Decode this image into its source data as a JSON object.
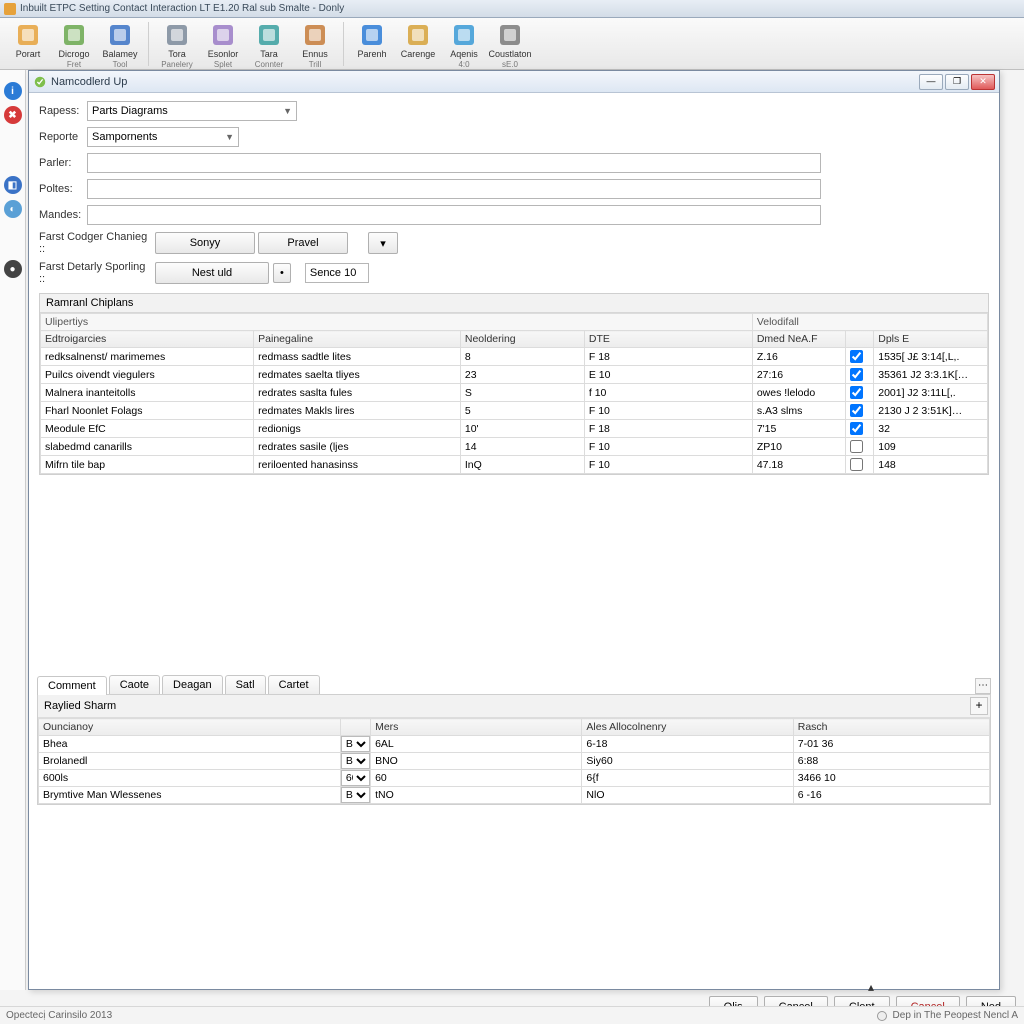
{
  "app_title": "Inbuilt ETPC Setting Contact Interaction LT E1.20 Ral sub Smalte - Donly",
  "ribbon": [
    {
      "label": "Porart",
      "sub": ""
    },
    {
      "label": "Dicrogo",
      "sub": "Fret"
    },
    {
      "label": "Balamey",
      "sub": "Tool"
    },
    {
      "label": "Tora",
      "sub": "Panelery"
    },
    {
      "label": "Esonlor",
      "sub": "Splet"
    },
    {
      "label": "Tara",
      "sub": "Connter"
    },
    {
      "label": "Ennus",
      "sub": "Trill"
    },
    {
      "label": "Parenh",
      "sub": ""
    },
    {
      "label": "Carenge",
      "sub": ""
    },
    {
      "label": "Aqenis",
      "sub": "4:0"
    },
    {
      "label": "Coustlaton",
      "sub": "sE.0"
    }
  ],
  "dialog_title": "Namcodlerd Up",
  "form": {
    "rapess_label": "Rapess:",
    "rapess_value": "Parts Diagrams",
    "reporte_label": "Reporte",
    "reporte_value": "Sampornents",
    "parler_label": "Parler:",
    "parler_value": "",
    "poltes_label": "Poltes:",
    "poltes_value": "",
    "mandes_label": "Mandes:",
    "mandes_value": "",
    "codger_label": "Farst Codger Chanieg ::",
    "sonyy_btn": "Sonyy",
    "pravel_btn": "Pravel",
    "detary_label": "Farst Detarly Sporling ::",
    "nest_btn": "Nest uld",
    "sence_label": "Sence 10"
  },
  "grid1": {
    "title": "Ramranl Chiplans",
    "sub_left": "Ulipertiys",
    "sub_right": "Velodifall",
    "cols": [
      "Edtroigarcies",
      "Painegaline",
      "Neoldering",
      "DTE",
      "Dmed NeA.F",
      "",
      "Dpls E"
    ],
    "rows": [
      [
        "redksalnenst/ marimemes",
        "redmass sadtle lites",
        "8",
        "F 18",
        "Z.16",
        "✓",
        "1535[ J£ 3:14[,L,."
      ],
      [
        "Puilcs oivendt viegulers",
        "redmates saelta tliyes",
        "23",
        "E 10",
        "27:16",
        "✓",
        "35361 J2 3:3.1K[…"
      ],
      [
        "Malnera inanteitolls",
        "redrates saslta fules",
        "S",
        "f 10",
        "owes !lelodo",
        "✓",
        "2001] J2 3:11L[,."
      ],
      [
        "Fharl Noonlet Folags",
        "redmates Makls lires",
        "5",
        "F 10",
        "s.A3 slms",
        "✓",
        "2130 J 2 3:51K]…"
      ],
      [
        "Meodule EfC",
        "redionigs",
        "10'",
        "F 18",
        "7'15",
        "✓",
        "32"
      ],
      [
        "slabedmd canarills",
        "redrates sasile (ljes",
        "14",
        "F 10",
        "ZP10",
        "",
        "109"
      ],
      [
        "Mifrn tile bap",
        "reriloented hanasinss",
        "InQ",
        "F 10",
        "47.18",
        "",
        "148"
      ]
    ]
  },
  "tabs": [
    "Comment",
    "Caote",
    "Deagan",
    "Satl",
    "Cartet"
  ],
  "subpanel": {
    "title": "Raylied Sharm",
    "cols": [
      "Ouncianoy",
      "",
      "Mers",
      "Ales Allocolnenry",
      "Rasch"
    ],
    "rows": [
      [
        "Bhea",
        "v",
        "6AL",
        "6-18",
        "7-01 36"
      ],
      [
        "Brolanedl",
        "v",
        "BNO",
        "Siy60",
        "6:88"
      ],
      [
        "600ls",
        "v",
        "60",
        "6{f",
        "3466 10"
      ],
      [
        "Brymtive Man Wlessenes",
        "v",
        "tNO",
        "NlO",
        "6 -16"
      ]
    ]
  },
  "footer": {
    "ok": "Olis",
    "cancel": "Cancel",
    "clent": "Clent",
    "cancel2": "Cancel",
    "ned": "Ned"
  },
  "status_left": "Opectecị Carinsilo 2013",
  "status_right": "Dep in The Peopest Nencl A"
}
